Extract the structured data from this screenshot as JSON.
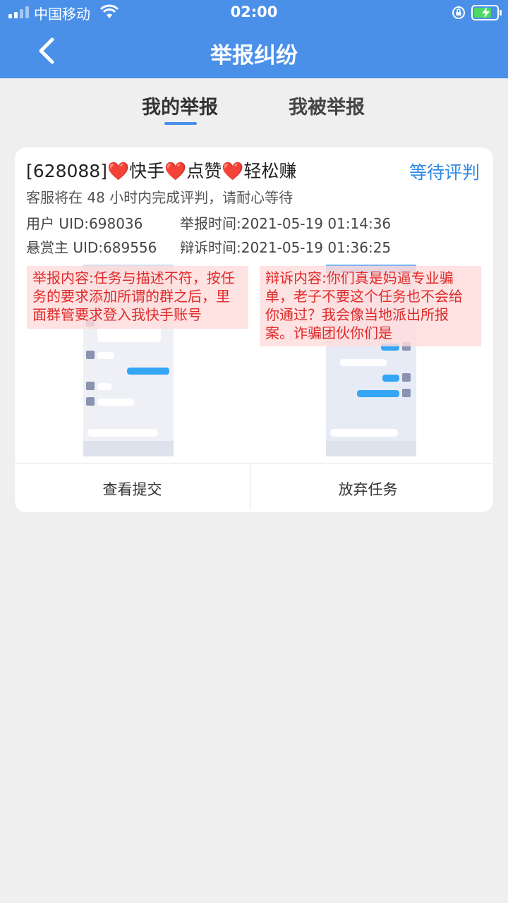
{
  "status_bar": {
    "carrier": "中国移动",
    "time": "02:00"
  },
  "header": {
    "title": "举报纠纷",
    "back_icon": "chevron-left-icon"
  },
  "tabs": [
    {
      "label": "我的举报",
      "active": true
    },
    {
      "label": "我被举报",
      "active": false
    }
  ],
  "report": {
    "task_id": "[628088]",
    "title_parts": [
      "快手",
      "点赞",
      "轻松赚"
    ],
    "heart": "❤️",
    "status": "等待评判",
    "notice": "客服将在 48 小时内完成评判，请耐心等待",
    "user_uid": "用户 UID:698036",
    "report_time": "举报时间:2021-05-19 01:14:36",
    "owner_uid": "悬赏主 UID:689556",
    "appeal_time": "辩诉时间:2021-05-19 01:36:25",
    "report_content": "举报内容:任务与描述不符，按任务的要求添加所谓的群之后，里面群管要求登入我快手账号",
    "appeal_content": "辩诉内容:你们真是妈逼专业骗单，老子不要这个任务也不会给你通过？我会像当地派出所报案。诈骗团伙你们是",
    "actions": {
      "view": "查看提交",
      "abandon": "放弃任务"
    }
  },
  "colors": {
    "primary": "#4a90e8",
    "status_blue": "#2e8ae6",
    "alert_red": "#e02a2a"
  }
}
